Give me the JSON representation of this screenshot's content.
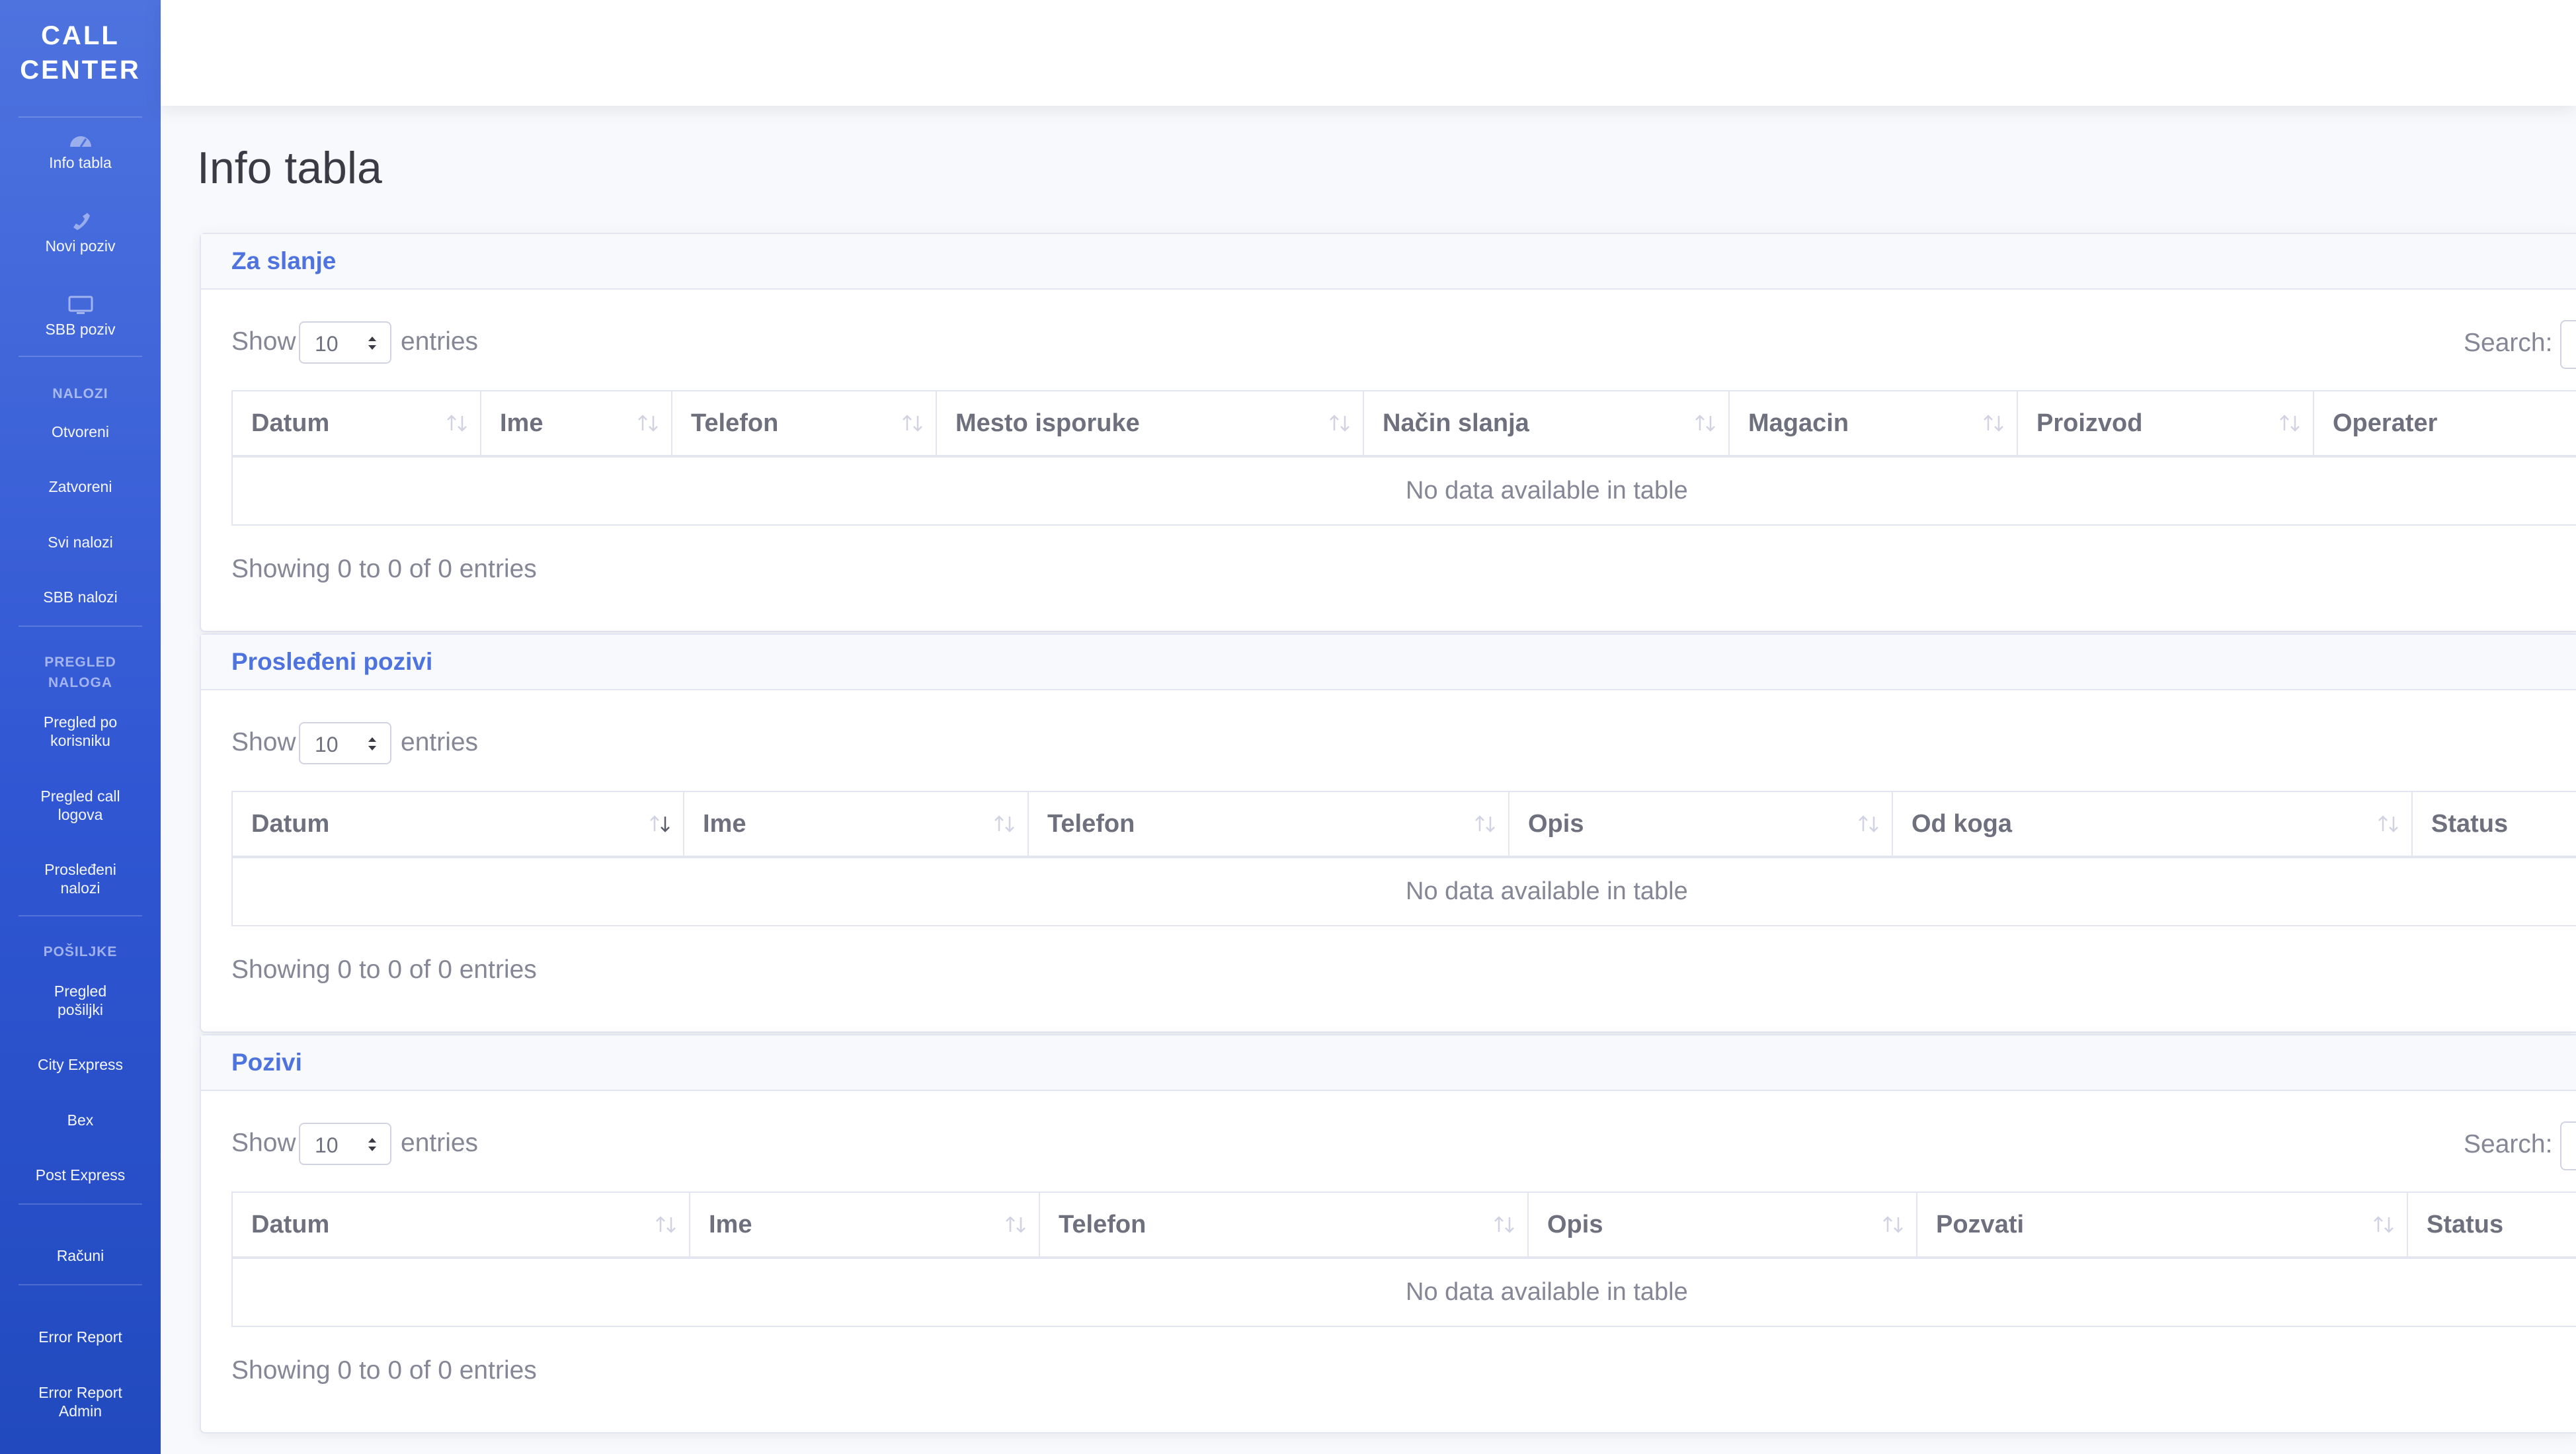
{
  "app": {
    "brand_line1": "CALL",
    "brand_line2": "CENTER"
  },
  "sidebar": {
    "top_items": [
      {
        "label": "Info tabla",
        "icon": "gauge-icon"
      },
      {
        "label": "Novi poziv",
        "icon": "phone-icon"
      },
      {
        "label": "SBB poziv",
        "icon": "monitor-icon"
      }
    ],
    "sections": [
      {
        "heading": "NALOZI",
        "items": [
          "Otvoreni",
          "Zatvoreni",
          "Svi nalozi",
          "SBB nalozi"
        ]
      },
      {
        "heading_line1": "PREGLED",
        "heading_line2": "NALOGA",
        "items": [
          {
            "line1": "Pregled po",
            "line2": "korisniku"
          },
          {
            "line1": "Pregled call",
            "line2": "logova"
          },
          {
            "line1": "Prosleđeni",
            "line2": "nalozi"
          }
        ]
      },
      {
        "heading": "POŠILJKE",
        "items_multi": [
          {
            "line1": "Pregled",
            "line2": "pošiljki"
          }
        ],
        "items": [
          "City Express",
          "Bex",
          "Post Express"
        ]
      }
    ],
    "racuni": "Računi",
    "error_report": "Error Report",
    "error_report_admin_line1": "Error Report",
    "error_report_admin_line2": "Admin"
  },
  "main": {
    "page_title": "Info tabla",
    "common": {
      "show": "Show",
      "entries": "entries",
      "page_length": "10",
      "search_label": "Search:",
      "empty": "No data available in table",
      "info": "Showing 0 to 0 of 0 entries"
    },
    "cards": [
      {
        "title": "Za slanje",
        "columns": [
          "Datum",
          "Ime",
          "Telefon",
          "Mesto isporuke",
          "Način slanja",
          "Magacin",
          "Proizvod",
          "Operater"
        ]
      },
      {
        "title": "Prosleđeni pozivi",
        "columns": [
          "Datum",
          "Ime",
          "Telefon",
          "Opis",
          "Od koga",
          "Status"
        ]
      },
      {
        "title": "Pozivi",
        "columns": [
          "Datum",
          "Ime",
          "Telefon",
          "Opis",
          "Pozvati",
          "Status"
        ]
      }
    ]
  },
  "colors": {
    "primary": "#4e73df",
    "sidebar_dark": "#224abe",
    "text": "#858796",
    "border": "#e3e6f0"
  }
}
